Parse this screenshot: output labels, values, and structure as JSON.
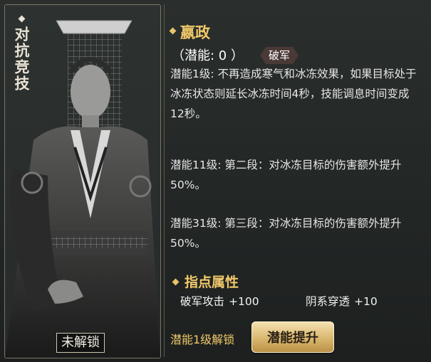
{
  "portrait": {
    "vertical_title": "对抗竞技",
    "locked_label": "未解锁"
  },
  "hero": {
    "name": "嬴政",
    "potential_text": "（潜能: 0 ）",
    "tag": "破军"
  },
  "potential_levels": [
    {
      "text": "潜能1级: 不再造成寒气和冰冻效果，如果目标处于冰冻状态则延长冰冻时间4秒，技能调息时间变成12秒。"
    },
    {
      "text": "潜能11级: 第二段：对冰冻目标的伤害额外提升50%。"
    },
    {
      "text": "潜能31级: 第三段：对冰冻目标的伤害额外提升50%。"
    }
  ],
  "attributes": {
    "title": "指点属性",
    "items": [
      {
        "label": "破军攻击",
        "value": "+100"
      },
      {
        "label": "阴系穿透",
        "value": "+10"
      }
    ]
  },
  "footer": {
    "unlock_hint": "潜能1级解锁",
    "upgrade_button": "潜能提升"
  },
  "colors": {
    "accent_gold": "#f1c96a",
    "panel_border": "#7a7566",
    "tag_bg": "#4a3936"
  }
}
